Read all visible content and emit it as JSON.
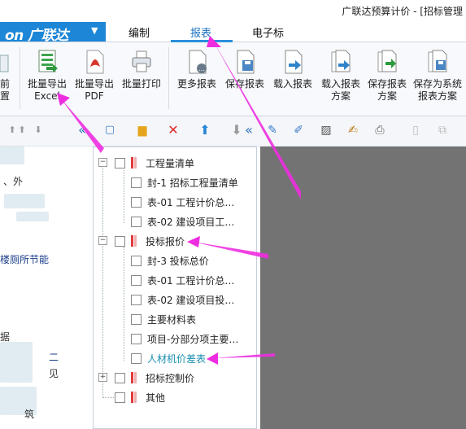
{
  "window": {
    "title": "广联达预算计价 - [招标管理"
  },
  "logo": {
    "text": "on 广联达",
    "dropdown": "▼"
  },
  "tabs": [
    {
      "label": "编制",
      "active": false
    },
    {
      "label": "报表",
      "active": true
    },
    {
      "label": "电子标",
      "active": false
    }
  ],
  "ribbon": {
    "left_partial": {
      "line1": "前",
      "line2": "置"
    },
    "buttons": [
      {
        "line1": "批量导出",
        "line2": "Excel",
        "icon": "excel-export-icon"
      },
      {
        "line1": "批量导出",
        "line2": "PDF",
        "icon": "pdf-export-icon"
      },
      {
        "line1": "批量打印",
        "line2": "",
        "icon": "print-icon"
      },
      {
        "line1": "更多报表",
        "line2": "",
        "icon": "more-reports-icon"
      },
      {
        "line1": "保存报表",
        "line2": "",
        "icon": "save-report-icon"
      },
      {
        "line1": "载入报表",
        "line2": "",
        "icon": "load-report-icon"
      },
      {
        "line1": "载入报表",
        "line2": "方案",
        "icon": "load-scheme-icon"
      },
      {
        "line1": "保存报表",
        "line2": "方案",
        "icon": "save-scheme-icon"
      },
      {
        "line1": "保存为系统",
        "line2": "报表方案",
        "icon": "save-system-scheme-icon"
      }
    ]
  },
  "left_panel": {
    "texts": [
      "、外",
      "楼厕所节能",
      "据",
      "二",
      "见",
      "筑"
    ]
  },
  "tree": {
    "groups": [
      {
        "label": "工程量清单",
        "expanded": true,
        "children": [
          "封-1 招标工程量清单",
          "表-01 工程计价总…",
          "表-02 建设项目工…"
        ]
      },
      {
        "label": "投标报价",
        "expanded": true,
        "children": [
          "封-3 投标总价",
          "表-01 工程计价总…",
          "表-02 建设项目投…",
          "主要材料表",
          "项目-分部分项主要…",
          "人材机价差表"
        ]
      },
      {
        "label": "招标控制价",
        "expanded": false,
        "children": []
      },
      {
        "label": "其他",
        "expanded": false,
        "children": []
      }
    ],
    "highlighted_item": "人材机价差表"
  },
  "colors": {
    "brand_blue": "#1d86d6",
    "active_tab": "#1a6fc0",
    "annotation_arrow": "#ee2de0",
    "highlight_text": "#1a8fb0",
    "viewer_bg": "#737373"
  }
}
